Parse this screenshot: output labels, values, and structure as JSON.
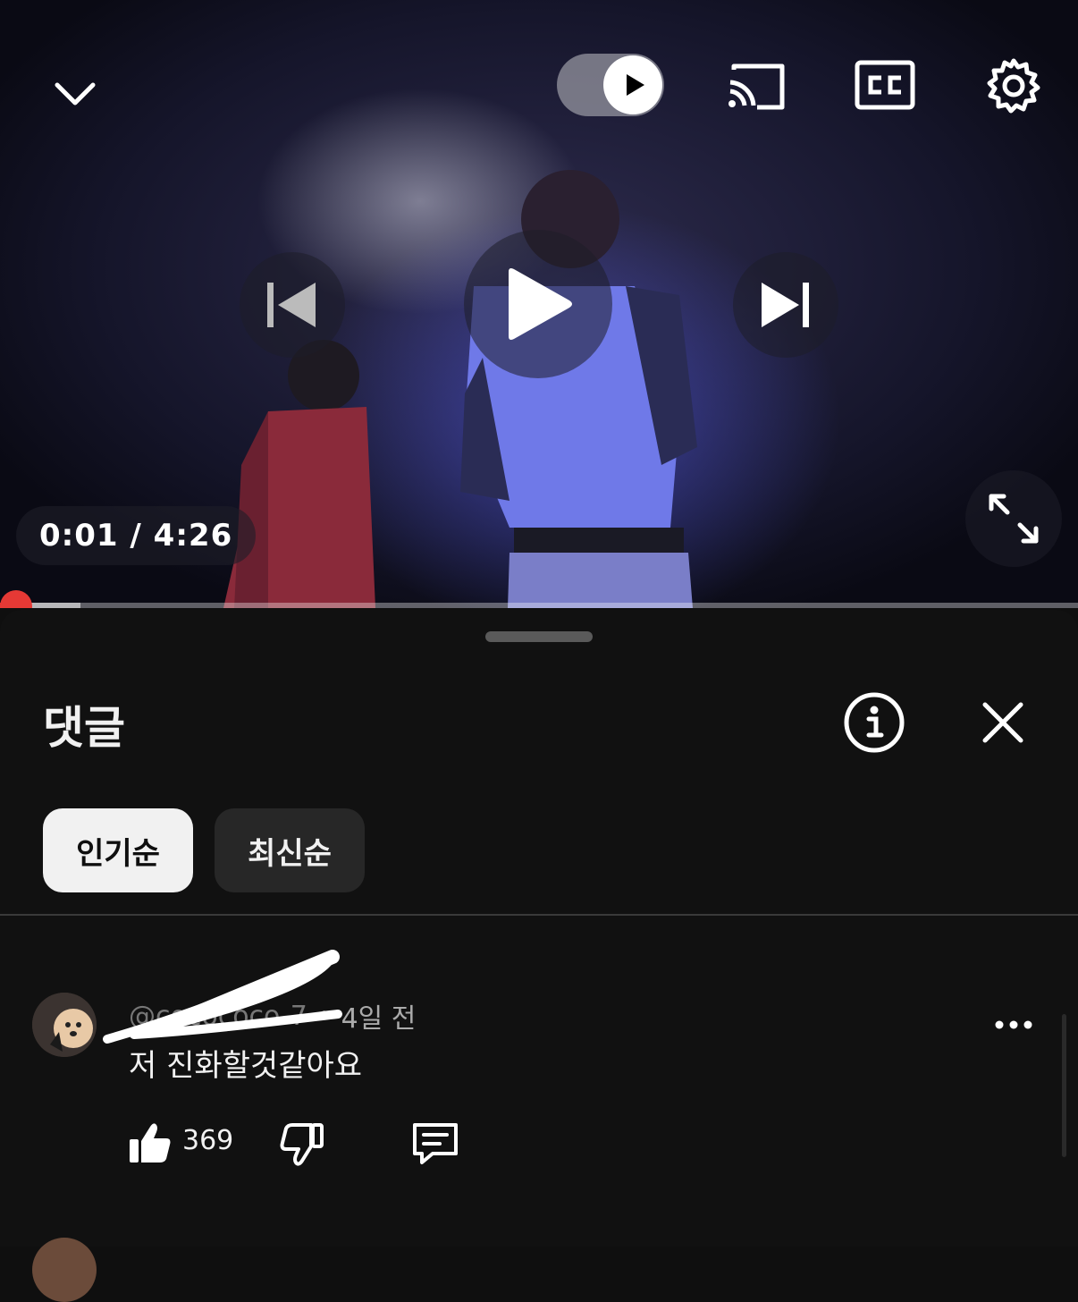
{
  "player": {
    "time_label": "0:01 / 4:26",
    "progress_fraction": 0.004,
    "autoplay": "on",
    "icons": [
      "chevron-down-icon",
      "autoplay-toggle-icon",
      "cast-icon",
      "closed-captions-icon",
      "gear-icon",
      "previous-icon",
      "play-icon",
      "next-icon",
      "fullscreen-icon"
    ]
  },
  "comments_panel": {
    "title": "댓글",
    "sort_chips": [
      {
        "label": "인기순",
        "selected": true
      },
      {
        "label": "최신순",
        "selected": false
      }
    ],
    "comments": [
      {
        "handle": "@cocococo-7",
        "time": "4일 전",
        "text": "저 진화할것같아요",
        "likes": "369"
      }
    ]
  },
  "colors": {
    "background": "#0f0f0f",
    "progress": "#e53935",
    "chip_selected_bg": "#f1f1f1",
    "chip_bg": "#272727"
  }
}
